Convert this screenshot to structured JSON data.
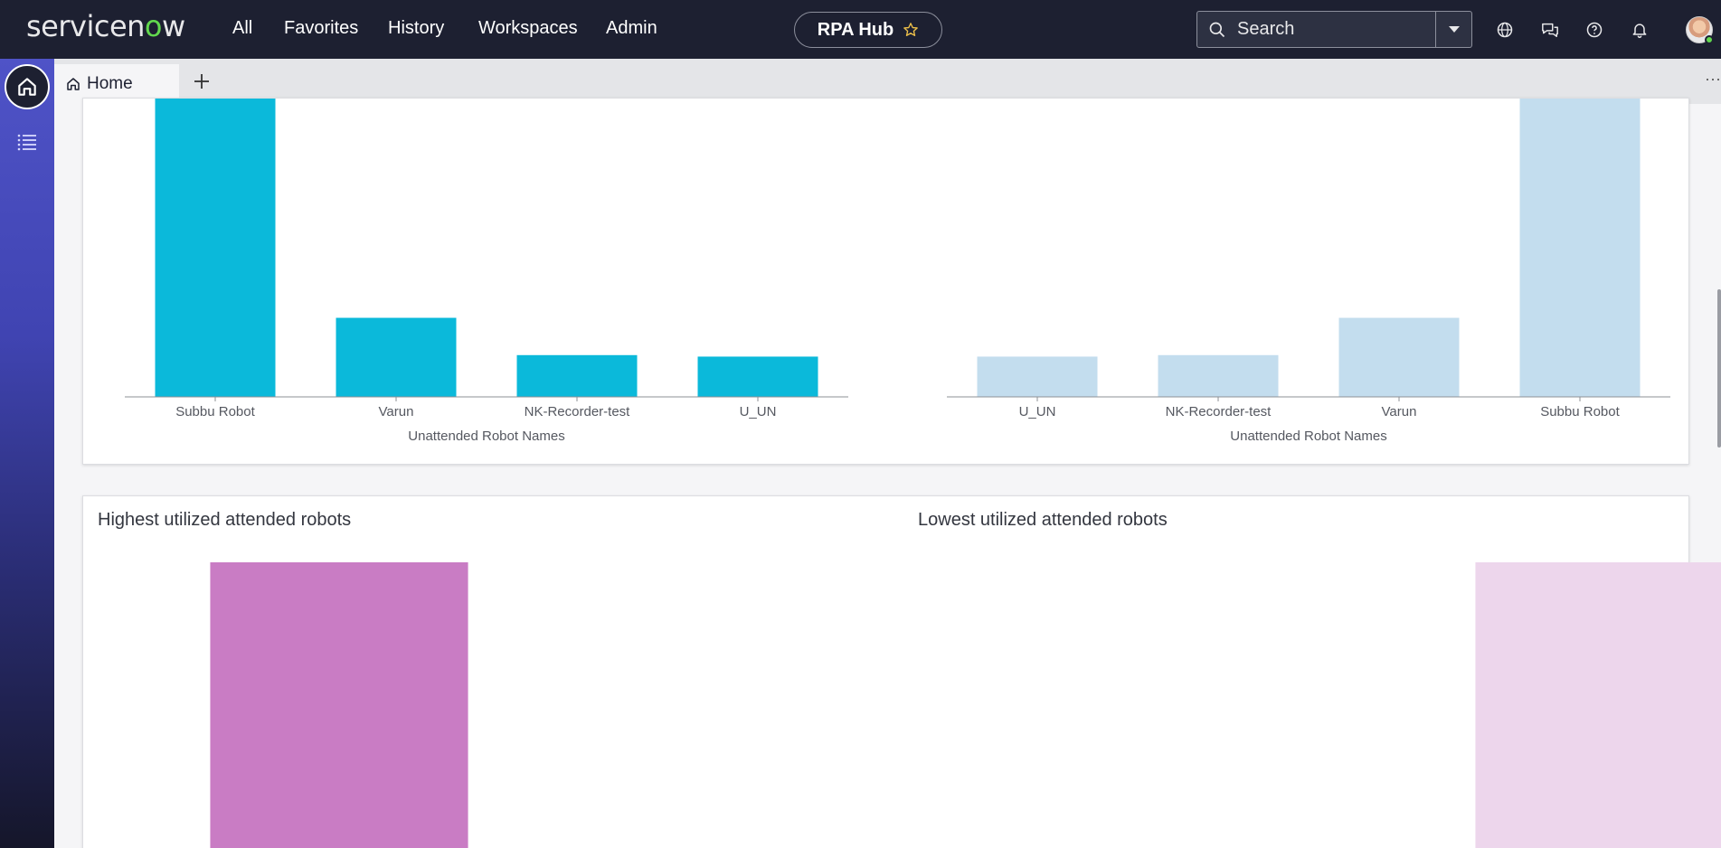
{
  "topbar": {
    "logo_text": "servicenow",
    "nav": [
      "All",
      "Favorites",
      "History",
      "Workspaces",
      "Admin"
    ],
    "workspace_pill": "RPA Hub",
    "search_placeholder": "Search",
    "icons": [
      "globe-icon",
      "chat-icon",
      "help-icon",
      "bell-icon"
    ]
  },
  "tabs": {
    "home_label": "Home",
    "more_label": "···"
  },
  "colors": {
    "unattended_highest": "#0bb9da",
    "unattended_lowest": "#c3ddee",
    "attended_highest": "#c97cc4",
    "attended_lowest": "#edd6ec"
  },
  "card_bottom": {
    "left_title": "Highest utilized attended robots",
    "right_title": "Lowest utilized attended robots"
  },
  "chart_data": [
    {
      "type": "bar",
      "categories": [
        "Subbu Robot",
        "Varun",
        "NK-Recorder-test",
        "U_UN"
      ],
      "values": [
        100,
        26.5,
        14,
        13.5
      ],
      "xlabel": "Unattended Robot Names",
      "ylabel": ""
    },
    {
      "type": "bar",
      "categories": [
        "U_UN",
        "NK-Recorder-test",
        "Varun",
        "Subbu Robot"
      ],
      "values": [
        13.5,
        14,
        26.5,
        100
      ],
      "xlabel": "Unattended Robot Names",
      "ylabel": ""
    },
    {
      "type": "bar",
      "title": "Highest utilized attended robots",
      "categories": [
        ""
      ],
      "values": [
        100
      ]
    },
    {
      "type": "bar",
      "title": "Lowest utilized attended robots",
      "categories": [
        ""
      ],
      "values": [
        100
      ]
    }
  ]
}
